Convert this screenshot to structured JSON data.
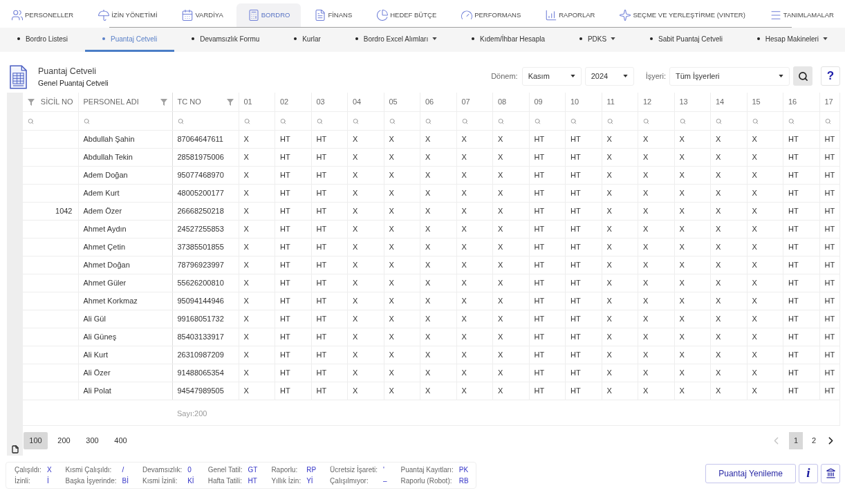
{
  "top_nav": [
    {
      "label": "PERSONELLER",
      "selected": false
    },
    {
      "label": "İZİN YÖNETİMİ",
      "selected": false
    },
    {
      "label": "VARDİYA",
      "selected": false
    },
    {
      "label": "BORDRO",
      "selected": true
    },
    {
      "label": "FİNANS",
      "selected": false
    },
    {
      "label": "HEDEF BÜTÇE",
      "selected": false
    },
    {
      "label": "PERFORMANS",
      "selected": false
    },
    {
      "label": "RAPORLAR",
      "selected": false
    },
    {
      "label": "SEÇME VE YERLEŞTİRME (VINTER)",
      "selected": false
    },
    {
      "label": "TANIMLAMALAR",
      "selected": false
    }
  ],
  "sub_nav": [
    {
      "label": "Bordro Listesi",
      "selected": false,
      "dropdown": false
    },
    {
      "label": "Puantaj Cetveli",
      "selected": true,
      "dropdown": false
    },
    {
      "label": "Devamsızlık Formu",
      "selected": false,
      "dropdown": false
    },
    {
      "label": "Kurlar",
      "selected": false,
      "dropdown": false
    },
    {
      "label": "Bordro Excel Alımları",
      "selected": false,
      "dropdown": true
    },
    {
      "label": "Kıdem/İhbar Hesapla",
      "selected": false,
      "dropdown": false
    },
    {
      "label": "PDKS",
      "selected": false,
      "dropdown": true
    },
    {
      "label": "Sabit Puantaj Cetveli",
      "selected": false,
      "dropdown": false
    },
    {
      "label": "Hesap Makineleri",
      "selected": false,
      "dropdown": true
    }
  ],
  "page_header": {
    "title": "Puantaj Cetveli",
    "subtitle": "Genel Puantaj Cetveli"
  },
  "filters": {
    "period_label": "Dönem:",
    "month": "Kasım",
    "year": "2024",
    "workplace_label": "İşyeri:",
    "workplace": "Tüm İşyerleri",
    "help_button": "?"
  },
  "table": {
    "columns": [
      {
        "label": "SİCİL NO",
        "right_aligned": true,
        "filterable": true
      },
      {
        "label": "PERSONEL ADI",
        "right_aligned": false,
        "filterable": true
      },
      {
        "label": "TC NO",
        "right_aligned": false,
        "filterable": true
      },
      {
        "label": "01",
        "right_aligned": false,
        "filterable": false
      },
      {
        "label": "02",
        "right_aligned": false,
        "filterable": false
      },
      {
        "label": "03",
        "right_aligned": false,
        "filterable": false
      },
      {
        "label": "04",
        "right_aligned": false,
        "filterable": false
      },
      {
        "label": "05",
        "right_aligned": false,
        "filterable": false
      },
      {
        "label": "06",
        "right_aligned": false,
        "filterable": false
      },
      {
        "label": "07",
        "right_aligned": false,
        "filterable": false
      },
      {
        "label": "08",
        "right_aligned": false,
        "filterable": false
      },
      {
        "label": "09",
        "right_aligned": false,
        "filterable": false
      },
      {
        "label": "10",
        "right_aligned": false,
        "filterable": false
      },
      {
        "label": "11",
        "right_aligned": false,
        "filterable": false
      },
      {
        "label": "12",
        "right_aligned": false,
        "filterable": false
      },
      {
        "label": "13",
        "right_aligned": false,
        "filterable": false
      },
      {
        "label": "14",
        "right_aligned": false,
        "filterable": false
      },
      {
        "label": "15",
        "right_aligned": false,
        "filterable": false
      },
      {
        "label": "16",
        "right_aligned": false,
        "filterable": false
      },
      {
        "label": "17",
        "right_aligned": false,
        "filterable": false
      }
    ],
    "rows": [
      {
        "name": "Abdullah Şahin",
        "tc_no": "87064647611",
        "days": [
          "X",
          "HT",
          "HT",
          "X",
          "X",
          "X",
          "X",
          "X",
          "HT",
          "HT",
          "X",
          "X",
          "X",
          "X",
          "X",
          "HT",
          "HT"
        ]
      },
      {
        "name": "Abdullah Tekin",
        "tc_no": "28581975006",
        "days": [
          "X",
          "HT",
          "HT",
          "X",
          "X",
          "X",
          "X",
          "X",
          "HT",
          "HT",
          "X",
          "X",
          "X",
          "X",
          "X",
          "HT",
          "HT"
        ]
      },
      {
        "name": "Adem Doğan",
        "tc_no": "95077468970",
        "days": [
          "X",
          "HT",
          "HT",
          "X",
          "X",
          "X",
          "X",
          "X",
          "HT",
          "HT",
          "X",
          "X",
          "X",
          "X",
          "X",
          "HT",
          "HT"
        ]
      },
      {
        "name": "Adem Kurt",
        "tc_no": "48005200177",
        "days": [
          "X",
          "HT",
          "HT",
          "X",
          "X",
          "X",
          "X",
          "X",
          "HT",
          "HT",
          "X",
          "X",
          "X",
          "X",
          "X",
          "HT",
          "HT"
        ]
      },
      {
        "sicil_no": "1042",
        "name": "Adem Özer",
        "tc_no": "26668250218",
        "days": [
          "X",
          "HT",
          "HT",
          "X",
          "X",
          "X",
          "X",
          "X",
          "HT",
          "HT",
          "X",
          "X",
          "X",
          "X",
          "X",
          "HT",
          "HT"
        ]
      },
      {
        "name": "Ahmet Aydın",
        "tc_no": "24527255853",
        "days": [
          "X",
          "HT",
          "HT",
          "X",
          "X",
          "X",
          "X",
          "X",
          "HT",
          "HT",
          "X",
          "X",
          "X",
          "X",
          "X",
          "HT",
          "HT"
        ]
      },
      {
        "name": "Ahmet Çetin",
        "tc_no": "37385501855",
        "days": [
          "X",
          "HT",
          "HT",
          "X",
          "X",
          "X",
          "X",
          "X",
          "HT",
          "HT",
          "X",
          "X",
          "X",
          "X",
          "X",
          "HT",
          "HT"
        ]
      },
      {
        "name": "Ahmet Doğan",
        "tc_no": "78796923997",
        "days": [
          "X",
          "HT",
          "HT",
          "X",
          "X",
          "X",
          "X",
          "X",
          "HT",
          "HT",
          "X",
          "X",
          "X",
          "X",
          "X",
          "HT",
          "HT"
        ]
      },
      {
        "name": "Ahmet Güler",
        "tc_no": "55626200810",
        "days": [
          "X",
          "HT",
          "HT",
          "X",
          "X",
          "X",
          "X",
          "X",
          "HT",
          "HT",
          "X",
          "X",
          "X",
          "X",
          "X",
          "HT",
          "HT"
        ]
      },
      {
        "name": "Ahmet Korkmaz",
        "tc_no": "95094144946",
        "days": [
          "X",
          "HT",
          "HT",
          "X",
          "X",
          "X",
          "X",
          "X",
          "HT",
          "HT",
          "X",
          "X",
          "X",
          "X",
          "X",
          "HT",
          "HT"
        ]
      },
      {
        "name": "Ali Gül",
        "tc_no": "99168051732",
        "days": [
          "X",
          "HT",
          "HT",
          "X",
          "X",
          "X",
          "X",
          "X",
          "HT",
          "HT",
          "X",
          "X",
          "X",
          "X",
          "X",
          "HT",
          "HT"
        ]
      },
      {
        "name": "Ali Güneş",
        "tc_no": "85403133917",
        "days": [
          "X",
          "HT",
          "HT",
          "X",
          "X",
          "X",
          "X",
          "X",
          "HT",
          "HT",
          "X",
          "X",
          "X",
          "X",
          "X",
          "HT",
          "HT"
        ]
      },
      {
        "name": "Ali Kurt",
        "tc_no": "26310987209",
        "days": [
          "X",
          "HT",
          "HT",
          "X",
          "X",
          "X",
          "X",
          "X",
          "HT",
          "HT",
          "X",
          "X",
          "X",
          "X",
          "X",
          "HT",
          "HT"
        ]
      },
      {
        "name": "Ali Özer",
        "tc_no": "91488065354",
        "days": [
          "X",
          "HT",
          "HT",
          "X",
          "X",
          "X",
          "X",
          "X",
          "HT",
          "HT",
          "X",
          "X",
          "X",
          "X",
          "X",
          "HT",
          "HT"
        ]
      },
      {
        "name": "Ali Polat",
        "tc_no": "94547989505",
        "days": [
          "X",
          "HT",
          "HT",
          "X",
          "X",
          "X",
          "X",
          "X",
          "HT",
          "HT",
          "X",
          "X",
          "X",
          "X",
          "X",
          "HT",
          "HT"
        ]
      }
    ],
    "footer": "Sayı:200"
  },
  "pagination": {
    "page_sizes": [
      {
        "label": "100",
        "selected": true
      },
      {
        "label": "200",
        "selected": false
      },
      {
        "label": "300",
        "selected": false
      },
      {
        "label": "400",
        "selected": false
      }
    ],
    "pages": [
      {
        "label": "1",
        "selected": true
      },
      {
        "label": "2",
        "selected": false
      }
    ],
    "prev_disabled": true,
    "next_disabled": false
  },
  "legend": [
    [
      {
        "label": "Çalışıldı:",
        "code": "X"
      },
      {
        "label": "Kısmi Çalışıldı:",
        "code": "/"
      },
      {
        "label": "Devamsızlık:",
        "code": "0"
      },
      {
        "label": "Genel Tatil:",
        "code": "GT"
      },
      {
        "label": "Raporlu:",
        "code": "RP"
      },
      {
        "label": "Ücretsiz İşareti:",
        "code": "'"
      },
      {
        "label": "Puantaj Kayıtları:",
        "code": "PK"
      }
    ],
    [
      {
        "label": "İzinli:",
        "code": "İ"
      },
      {
        "label": "Başka İşyerinde:",
        "code": "Bİ"
      },
      {
        "label": "Kısmi İzinli:",
        "code": "Kİ"
      },
      {
        "label": "Hafta Tatili:",
        "code": "HT"
      },
      {
        "label": "Yıllık İzin:",
        "code": "Yİ"
      },
      {
        "label": "Çalışılmıyor:",
        "code": "–"
      },
      {
        "label": "Raporlu (Robot):",
        "code": "RB"
      }
    ]
  ],
  "actions": {
    "refresh_button": "Puantaj Yenileme",
    "info_button": "i"
  }
}
